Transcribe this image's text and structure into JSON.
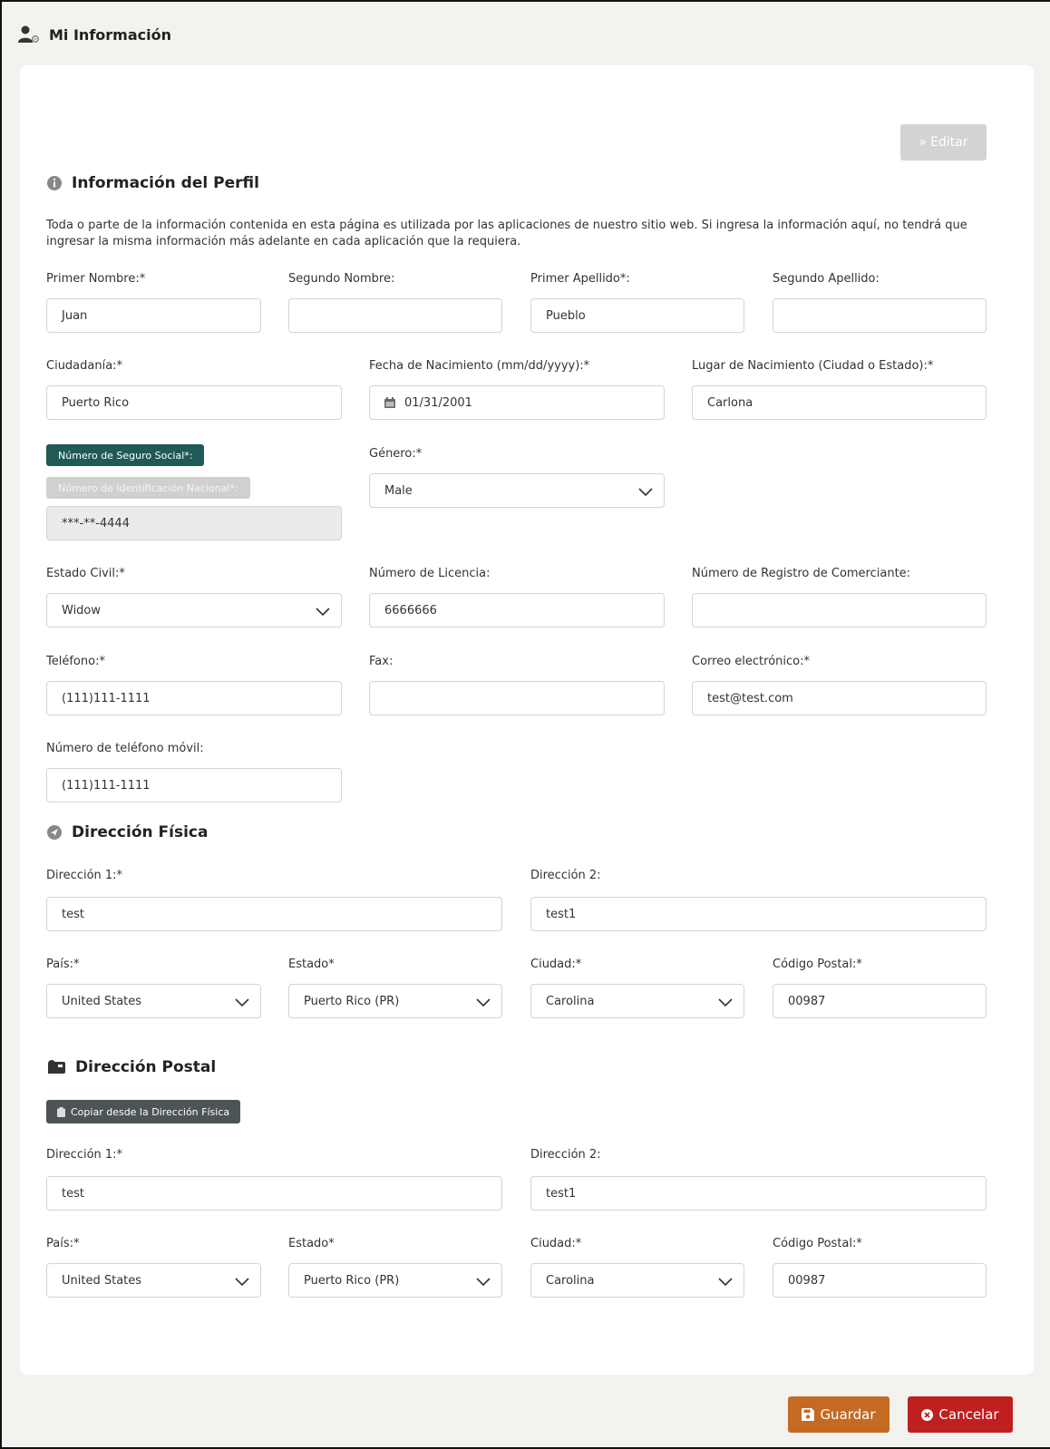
{
  "header": {
    "title": "Mi Información",
    "icon": "user-gear-icon"
  },
  "actions": {
    "edit_label": "Editar",
    "save_label": "Guardar",
    "cancel_label": "Cancelar"
  },
  "profile": {
    "section_title": "Información del Perfil",
    "description": "Toda o parte de la información contenida en esta página es utilizada por las aplicaciones de nuestro sitio web. Si ingresa la información aquí, no tendrá que ingresar la misma información más adelante en cada aplicación que la requiera.",
    "first_name": {
      "label": "Primer Nombre:*",
      "value": "Juan"
    },
    "middle_name": {
      "label": "Segundo Nombre:",
      "value": ""
    },
    "last_name": {
      "label": "Primer Apellido*:",
      "value": "Pueblo"
    },
    "second_last_name": {
      "label": "Segundo Apellido:",
      "value": ""
    },
    "citizenship": {
      "label": "Ciudadanía:*",
      "value": "Puerto Rico"
    },
    "birth_date": {
      "label": "Fecha de Nacimiento (mm/dd/yyyy):*",
      "value": "01/31/2001"
    },
    "birth_place": {
      "label": "Lugar de Nacimiento (Ciudad o Estado):*",
      "value": "Carlona"
    },
    "ssn_label": "Número de Seguro Social*:",
    "national_id_label": "Número de Identificación Nacional*:",
    "ssn_value": "***-**-4444",
    "gender": {
      "label": "Género:*",
      "value": "Male"
    },
    "marital_status": {
      "label": "Estado Civil:*",
      "value": "Widow"
    },
    "license_number": {
      "label": "Número de Licencia:",
      "value": "6666666"
    },
    "merchant_registry": {
      "label": "Número de Registro de Comerciante:",
      "value": ""
    },
    "phone": {
      "label": "Teléfono:*",
      "value": "(111)111-1111"
    },
    "fax": {
      "label": "Fax:",
      "value": ""
    },
    "email": {
      "label": "Correo electrónico:*",
      "value": "test@test.com"
    },
    "mobile": {
      "label": "Número de teléfono móvil:",
      "value": "(111)111-1111"
    }
  },
  "physical_address": {
    "section_title": "Dirección Física",
    "address1": {
      "label": "Dirección 1:*",
      "value": "test"
    },
    "address2": {
      "label": "Dirección 2:",
      "value": "test1"
    },
    "country": {
      "label": "País:*",
      "value": "United States"
    },
    "state": {
      "label": "Estado*",
      "value": "Puerto Rico (PR)"
    },
    "city": {
      "label": "Ciudad:*",
      "value": "Carolina"
    },
    "zip": {
      "label": "Código Postal:*",
      "value": "00987"
    }
  },
  "postal_address": {
    "section_title": "Dirección Postal",
    "copy_button": "Copiar desde la Dirección Física",
    "address1": {
      "label": "Dirección 1:*",
      "value": "test"
    },
    "address2": {
      "label": "Dirección 2:",
      "value": "test1"
    },
    "country": {
      "label": "País:*",
      "value": "United States"
    },
    "state": {
      "label": "Estado*",
      "value": "Puerto Rico (PR)"
    },
    "city": {
      "label": "Ciudad:*",
      "value": "Carolina"
    },
    "zip": {
      "label": "Código Postal:*",
      "value": "00987"
    }
  },
  "colors": {
    "accent_dark": "#1f5a57",
    "save": "#c46a23",
    "cancel": "#bf1f1f",
    "copy": "#4d5457"
  }
}
